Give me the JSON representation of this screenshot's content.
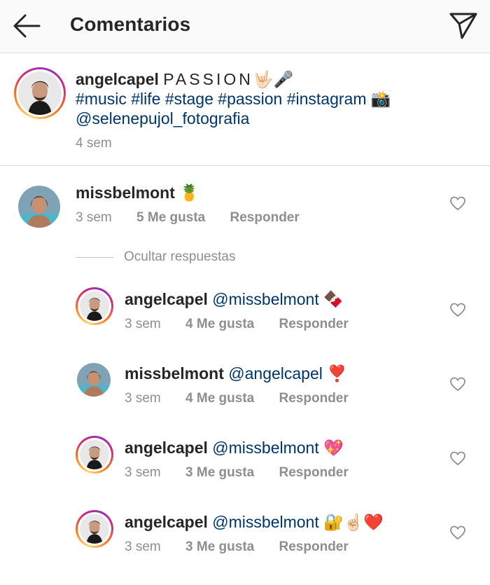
{
  "header": {
    "title": "Comentarios",
    "back_icon": "arrow-left-icon",
    "share_icon": "paper-plane-icon"
  },
  "caption": {
    "username": "angelcapel",
    "text_spaced": "PASSION",
    "emoji_1": "🤟🏻🎤",
    "hashtags": "#music #life #stage #passion #instagram",
    "emoji_2": "📸",
    "mention": "@selenepujol_fotografia",
    "time": "4 sem"
  },
  "comments": [
    {
      "username": "missbelmont",
      "mention": "",
      "emoji": "🍍",
      "time": "3 sem",
      "likes": "5 Me gusta",
      "reply": "Responder"
    },
    {
      "username": "angelcapel",
      "mention": "@missbelmont",
      "emoji": "🍫",
      "time": "3 sem",
      "likes": "4 Me gusta",
      "reply": "Responder"
    },
    {
      "username": "missbelmont",
      "mention": "@angelcapel",
      "emoji": "❣️",
      "time": "3 sem",
      "likes": "4 Me gusta",
      "reply": "Responder"
    },
    {
      "username": "angelcapel",
      "mention": "@missbelmont",
      "emoji": "💖",
      "time": "3 sem",
      "likes": "3 Me gusta",
      "reply": "Responder"
    },
    {
      "username": "angelcapel",
      "mention": "@missbelmont",
      "emoji": "🔐☝🏻❤️",
      "time": "3 sem",
      "likes": "3 Me gusta",
      "reply": "Responder"
    }
  ],
  "replies_toggle": "Ocultar respuestas",
  "colors": {
    "text": "#262626",
    "secondary": "#8e8e8e",
    "link": "#003569",
    "divider": "#dbdbdb"
  }
}
